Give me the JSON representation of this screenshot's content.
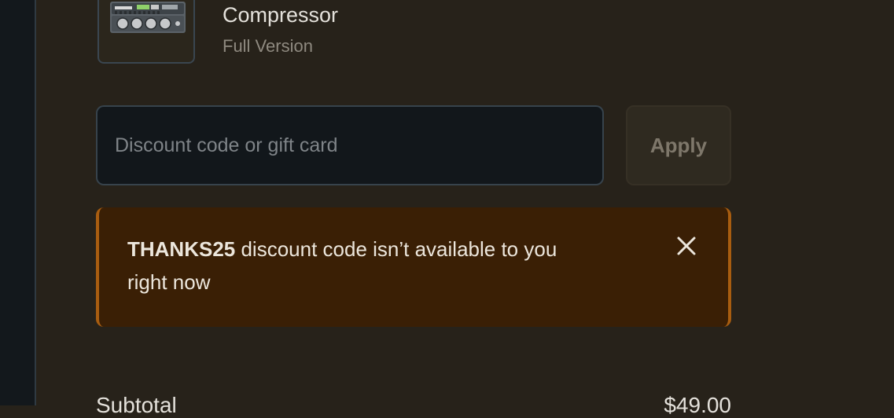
{
  "product": {
    "name": "Compressor",
    "variant": "Full Version",
    "thumbnail_icon": "compressor-plugin-thumbnail"
  },
  "discount": {
    "input_value": "",
    "placeholder": "Discount code or gift card",
    "apply_label": "Apply"
  },
  "alert": {
    "code": "THANKS25",
    "message_line1": " discount code isn’t available to you",
    "message_line2": "right now",
    "close_icon": "close-icon",
    "accent_color": "#a85d10"
  },
  "summary": {
    "subtotal_label": "Subtotal",
    "subtotal_value": "$49.00"
  }
}
